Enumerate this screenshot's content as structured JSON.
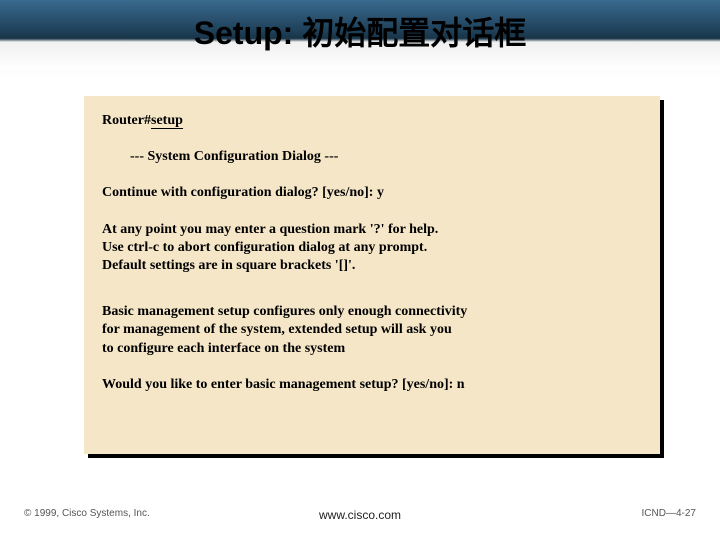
{
  "slide": {
    "title": "Setup: 初始配置对话框"
  },
  "terminal": {
    "prompt": "Router#",
    "command": "setup",
    "dialog_header": "--- System Configuration Dialog ---",
    "continue_prompt": "Continue with configuration dialog? [yes/no]: y",
    "help1": "At any point you may enter a question mark '?' for help.",
    "help2": "Use ctrl-c to abort configuration dialog at any prompt.",
    "help3": "Default settings are in square brackets '[]'.",
    "basic1": "Basic management setup configures only enough connectivity",
    "basic2": "for management of the system, extended setup will ask you",
    "basic3": "to configure each interface on the system",
    "basic_prompt": "Would you like to enter basic management setup? [yes/no]: n"
  },
  "footer": {
    "copyright": "© 1999, Cisco Systems, Inc.",
    "url": "www.cisco.com",
    "page": "ICND—4-27"
  }
}
